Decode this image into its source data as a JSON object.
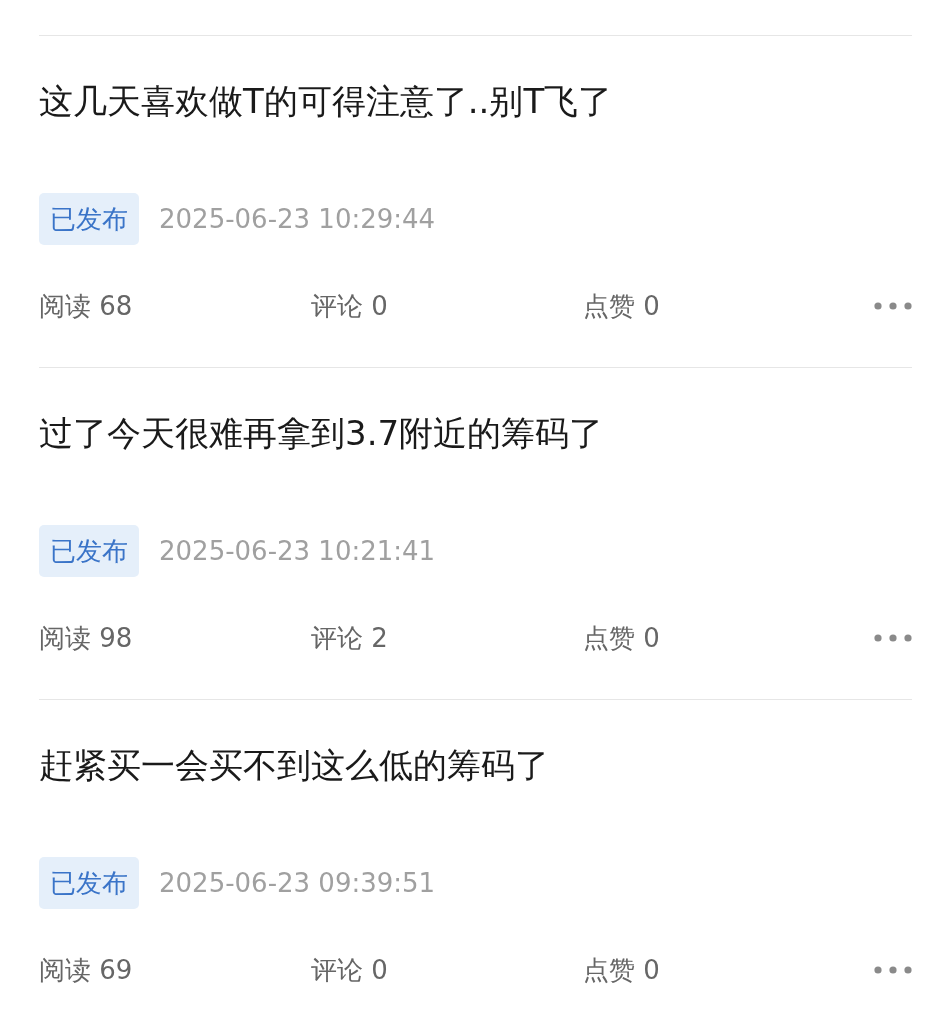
{
  "posts": [
    {
      "title": "这几天喜欢做T的可得注意了..别T飞了",
      "status": "已发布",
      "time": "2025-06-23 10:29:44",
      "reads": "阅读 68",
      "comments": "评论 0",
      "likes": "点赞 0"
    },
    {
      "title": "过了今天很难再拿到3.7附近的筹码了",
      "status": "已发布",
      "time": "2025-06-23 10:21:41",
      "reads": "阅读 98",
      "comments": "评论 2",
      "likes": "点赞 0"
    },
    {
      "title": "赶紧买一会买不到这么低的筹码了",
      "status": "已发布",
      "time": "2025-06-23 09:39:51",
      "reads": "阅读 69",
      "comments": "评论 0",
      "likes": "点赞 0"
    }
  ]
}
